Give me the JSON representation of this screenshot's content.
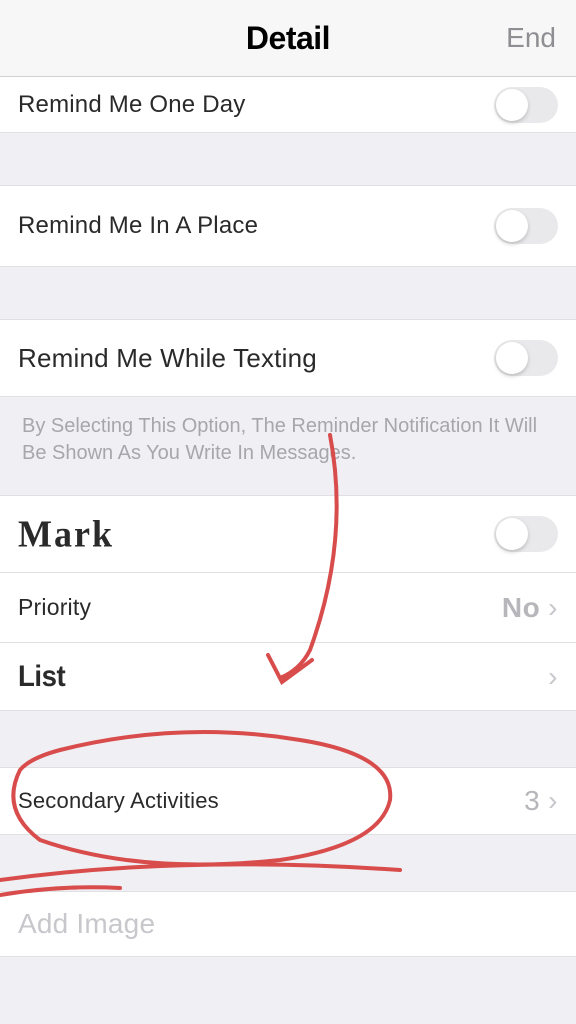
{
  "header": {
    "title": "Detail",
    "end": "End"
  },
  "rows": {
    "remind_day": "Remind Me One Day",
    "remind_place": "Remind Me In A Place",
    "remind_texting": "Remind Me While Texting",
    "texting_note": "By Selecting This Option, The Reminder Notification It Will Be Shown As You Write In Messages.",
    "mark": "Mark",
    "priority_label": "Priority",
    "priority_value": "No",
    "list": "List",
    "secondary_label": "Secondary Activities",
    "secondary_value": "3",
    "add_image": "Add Image"
  },
  "annotation_color": "#d84c4c"
}
